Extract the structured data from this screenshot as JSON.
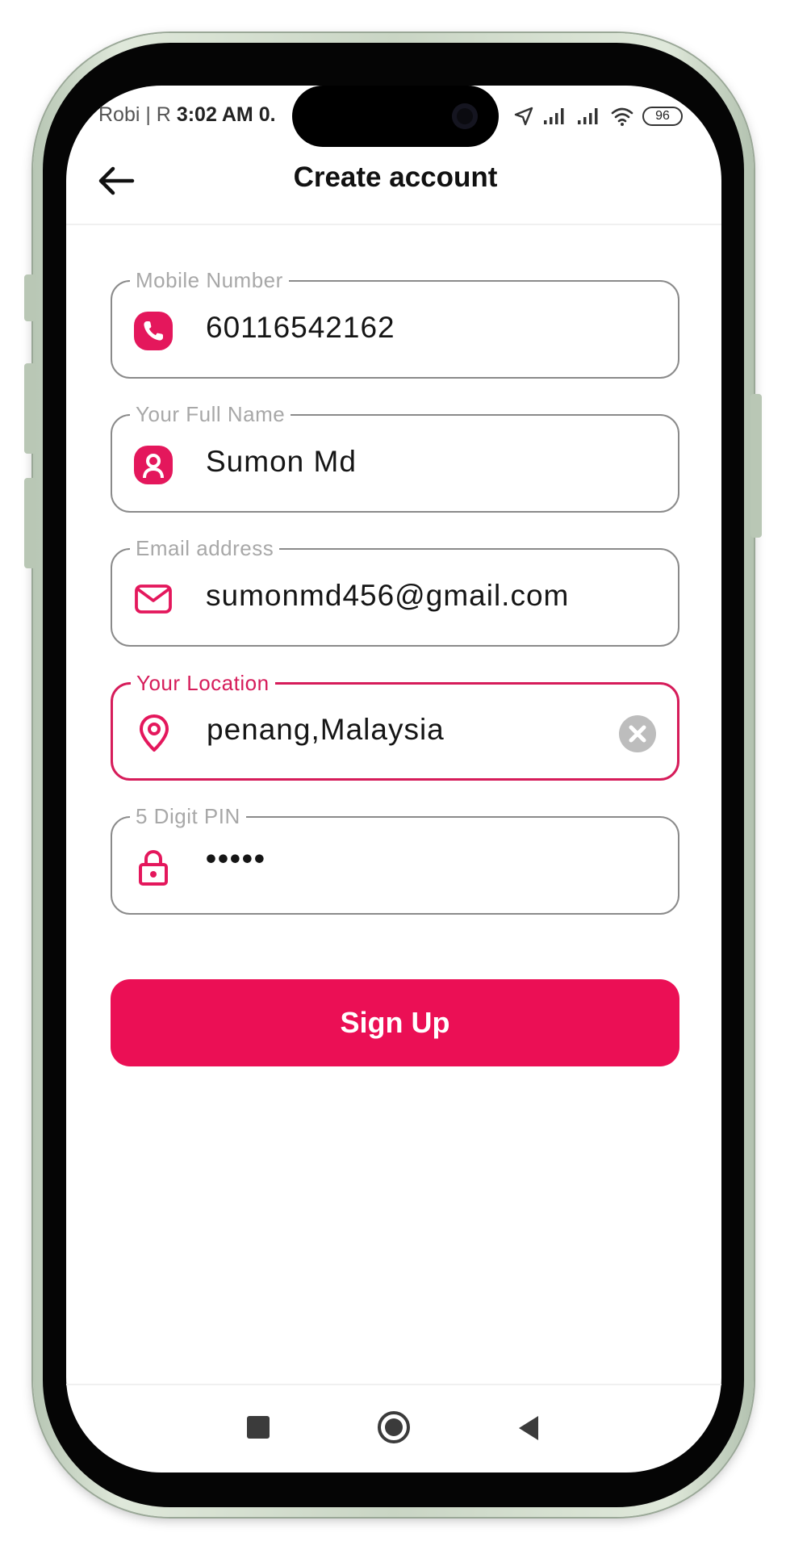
{
  "status_bar": {
    "carrier": "Robi | R",
    "time": "3:02 AM",
    "data_rate": "0.",
    "battery": "96",
    "icons": [
      "location-arrow-icon",
      "signal-icon",
      "signal-icon",
      "wifi-icon",
      "battery-icon"
    ]
  },
  "header": {
    "title": "Create account",
    "back_icon": "arrow-left-icon"
  },
  "form": {
    "mobile": {
      "label": "Mobile Number",
      "value": "60116542162",
      "icon": "phone-icon"
    },
    "name": {
      "label": "Your Full Name",
      "value": "Sumon Md",
      "icon": "user-icon"
    },
    "email": {
      "label": "Email address",
      "value": "sumonmd456@gmail.com",
      "icon": "mail-icon"
    },
    "location": {
      "label": "Your Location",
      "value": "penang,Malaysia",
      "icon": "location-pin-icon",
      "clear_icon": "clear-icon"
    },
    "pin": {
      "label": "5 Digit PIN",
      "value": "•••••",
      "icon": "lock-icon"
    }
  },
  "signup_label": "Sign Up",
  "nav_bar": {
    "icons": [
      "recents-icon",
      "home-icon",
      "back-icon"
    ]
  },
  "colors": {
    "accent": "#eb0f55",
    "field_border": "#8a8a8a",
    "active_border": "#d61c5a",
    "label": "#a8a8a8"
  }
}
